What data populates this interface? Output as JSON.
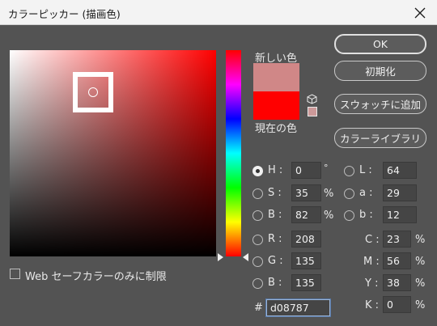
{
  "window": {
    "title": "カラーピッカー (描画色)"
  },
  "swatch": {
    "new_label": "新しい色",
    "current_label": "現在の色",
    "new_color": "#d08787",
    "current_color": "#ff0000",
    "websafe_color": "#cc9999",
    "cube_icon": "cube-icon"
  },
  "buttons": {
    "ok": "OK",
    "reset": "初期化",
    "add_swatch": "スウォッチに追加",
    "libraries": "カラーライブラリ"
  },
  "hsb": {
    "h": {
      "label": "H :",
      "value": "0",
      "unit": "°"
    },
    "s": {
      "label": "S :",
      "value": "35",
      "unit": "%"
    },
    "b": {
      "label": "B :",
      "value": "82",
      "unit": "%"
    }
  },
  "rgb": {
    "r": {
      "label": "R :",
      "value": "208"
    },
    "g": {
      "label": "G :",
      "value": "135"
    },
    "b": {
      "label": "B :",
      "value": "135"
    }
  },
  "lab": {
    "l": {
      "label": "L :",
      "value": "64"
    },
    "a": {
      "label": "a :",
      "value": "29"
    },
    "b": {
      "label": "b :",
      "value": "12"
    }
  },
  "cmyk": {
    "c": {
      "label": "C :",
      "value": "23",
      "unit": "%"
    },
    "m": {
      "label": "M :",
      "value": "56",
      "unit": "%"
    },
    "y": {
      "label": "Y :",
      "value": "38",
      "unit": "%"
    },
    "k": {
      "label": "K :",
      "value": "0",
      "unit": "%"
    }
  },
  "hex": {
    "label": "#",
    "value": "d08787"
  },
  "websafe_checkbox": {
    "label": "Web セーフカラーのみに制限",
    "checked": false
  },
  "selected_mode": "H"
}
